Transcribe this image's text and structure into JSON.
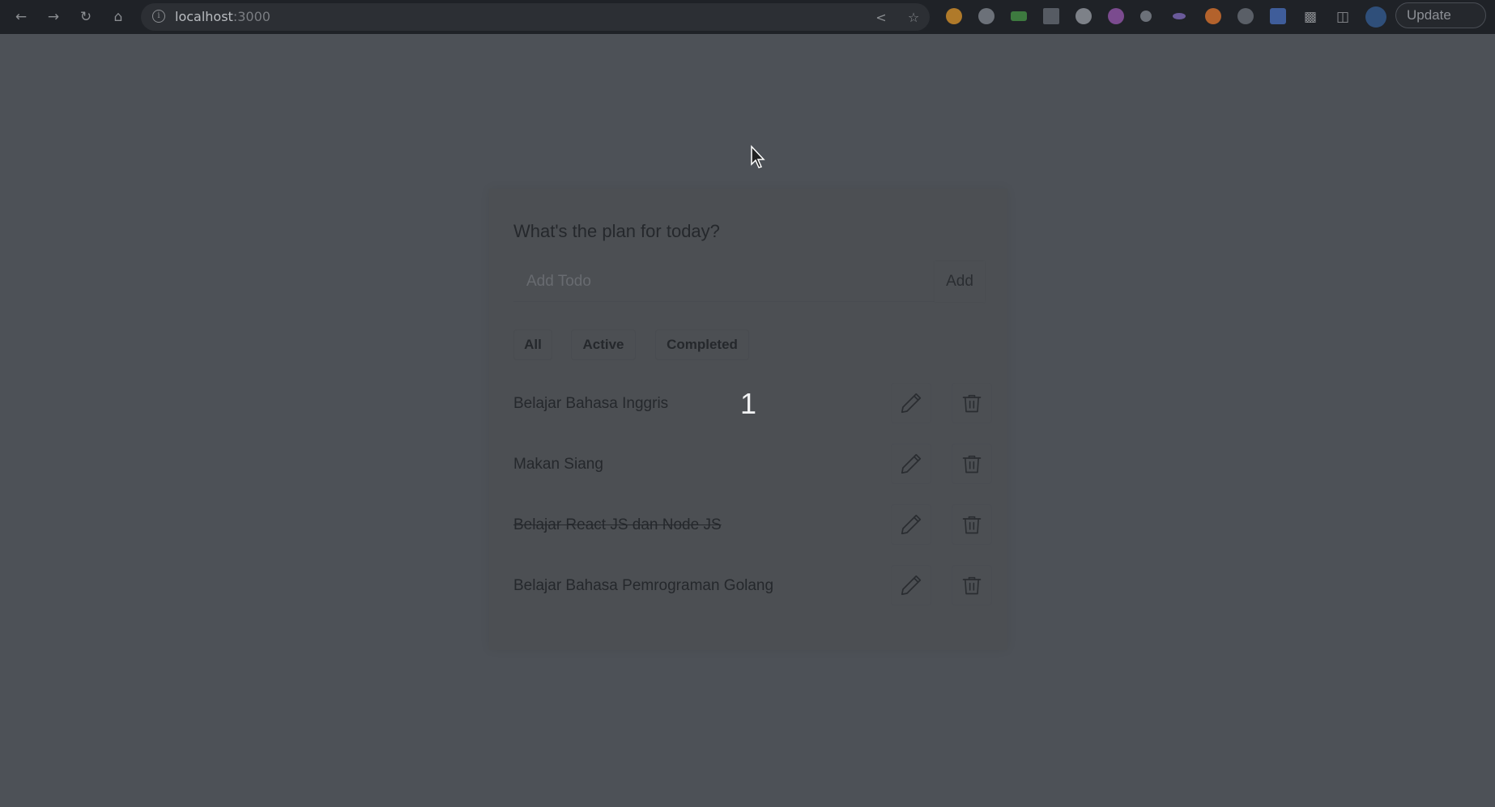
{
  "browser": {
    "url_host": "localhost",
    "url_port": ":3000",
    "update_label": "Update"
  },
  "app": {
    "title": "What's the plan for today?",
    "input_placeholder": "Add Todo",
    "add_label": "Add",
    "filters": [
      "All",
      "Active",
      "Completed"
    ],
    "todos": [
      {
        "text": "Belajar Bahasa Inggris",
        "completed": false,
        "badge": "1"
      },
      {
        "text": "Makan Siang",
        "completed": false,
        "badge": ""
      },
      {
        "text": "Belajar React JS dan Node JS",
        "completed": true,
        "badge": ""
      },
      {
        "text": "Belajar Bahasa Pemrograman Golang",
        "completed": false,
        "badge": ""
      }
    ]
  },
  "colors": {
    "page_background": "#4d5157",
    "card_background": "#4c4f53",
    "text": "#25282c",
    "browser_bar": "#1f2227"
  }
}
